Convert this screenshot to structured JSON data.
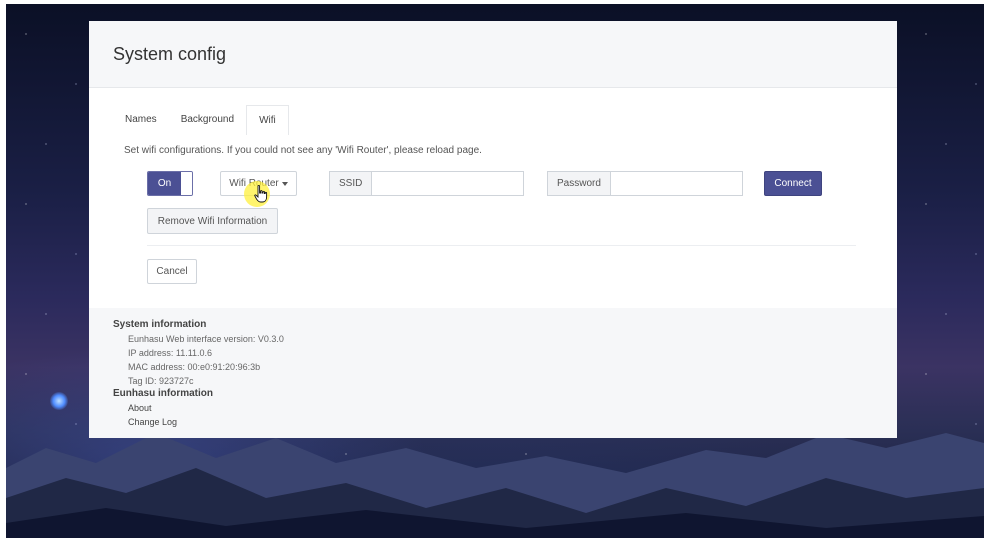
{
  "header": {
    "title": "System config"
  },
  "tabs": [
    {
      "label": "Names"
    },
    {
      "label": "Background"
    },
    {
      "label": "Wifi"
    }
  ],
  "wifi": {
    "description": "Set wifi configurations. If you could not see any 'Wifi Router', please reload page.",
    "toggle_label": "On",
    "router_dropdown_label": "Wifi Router",
    "ssid_label": "SSID",
    "ssid_value": "",
    "password_label": "Password",
    "password_value": "",
    "connect_label": "Connect",
    "remove_label": "Remove Wifi Information",
    "cancel_label": "Cancel"
  },
  "footer": {
    "system_title": "System information",
    "system_lines": [
      "Eunhasu Web interface version: V0.3.0",
      "IP address: 11.11.0.6",
      "MAC address: 00:e0:91:20:96:3b",
      "Tag ID: 923727c"
    ],
    "eunhasu_title": "Eunhasu information",
    "links": [
      "About",
      "Change Log"
    ]
  },
  "colors": {
    "primary": "#4b5094",
    "cursor_highlight": "#fff03c"
  },
  "icons": {
    "cursor": "hand-pointer-icon",
    "dropdown": "caret-down-icon"
  }
}
